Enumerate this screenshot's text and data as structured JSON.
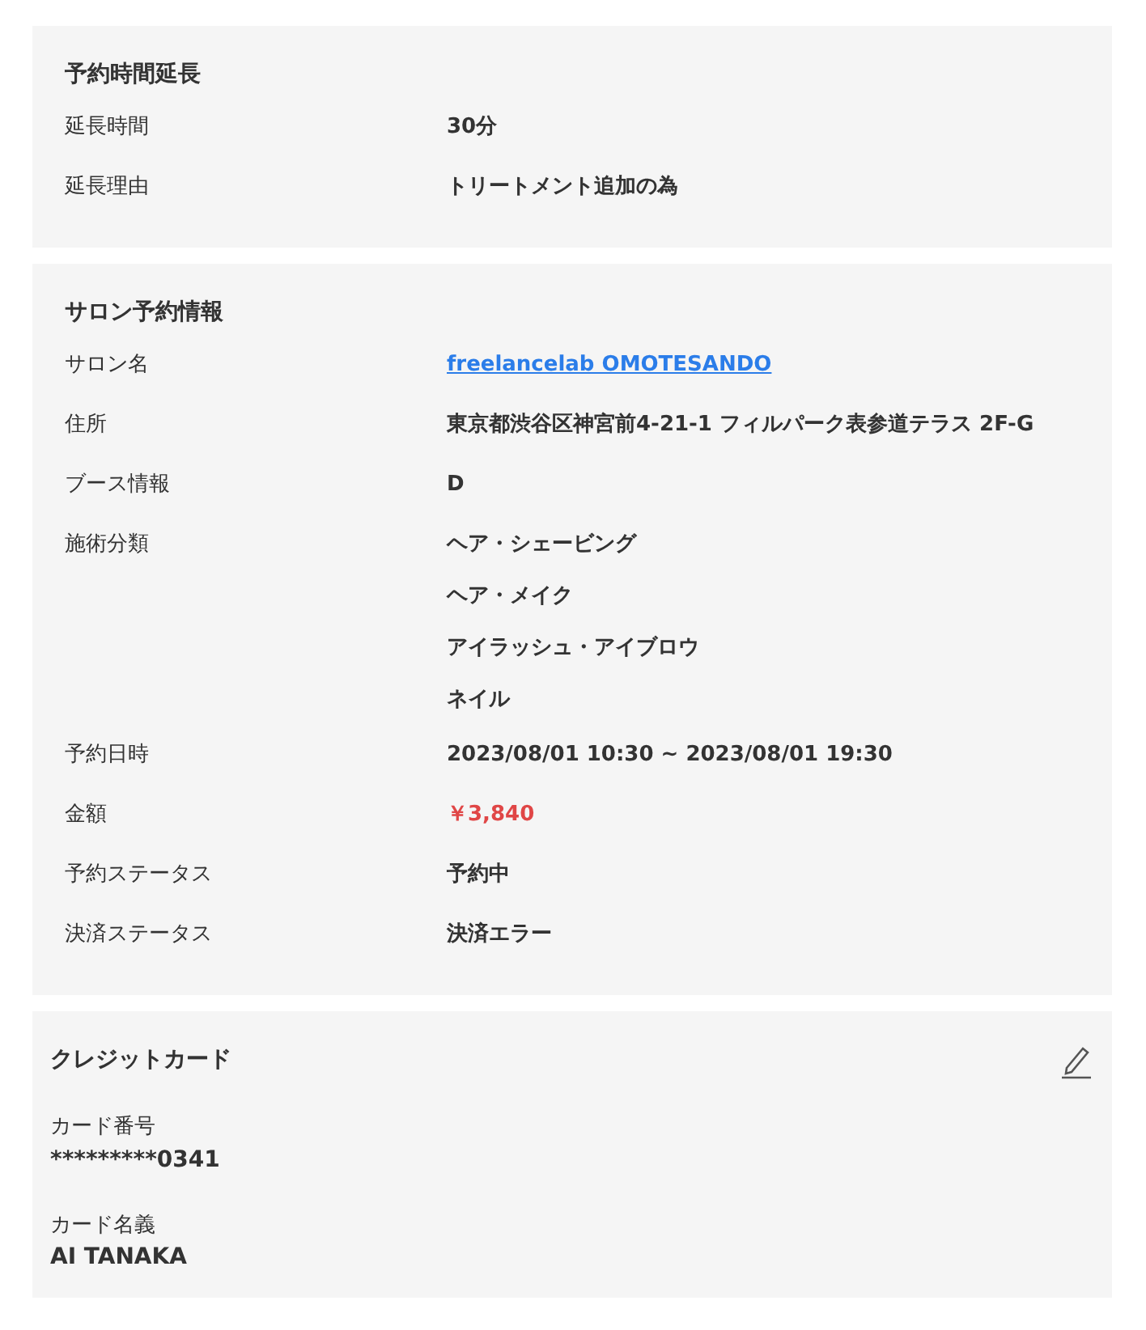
{
  "extension": {
    "title": "予約時間延長",
    "rows": [
      {
        "label": "延長時間",
        "kind": "text",
        "value": "30分"
      },
      {
        "label": "延長理由",
        "kind": "text",
        "value": "トリートメント追加の為"
      }
    ]
  },
  "salon": {
    "title": "サロン予約情報",
    "rows": [
      {
        "label": "サロン名",
        "kind": "link",
        "value": "freelancelab OMOTESANDO"
      },
      {
        "label": "住所",
        "kind": "text",
        "value": "東京都渋谷区神宮前4-21-1 フィルパーク表参道テラス 2F-G"
      },
      {
        "label": "ブース情報",
        "kind": "text",
        "value": "D"
      },
      {
        "label": "施術分類",
        "kind": "list",
        "values": [
          "ヘア・シェービング",
          "ヘア・メイク",
          "アイラッシュ・アイブロウ",
          "ネイル"
        ]
      },
      {
        "label": "予約日時",
        "kind": "text",
        "value": "2023/08/01 10:30 ~ 2023/08/01 19:30"
      },
      {
        "label": "金額",
        "kind": "price",
        "value": "￥3,840"
      },
      {
        "label": "予約ステータス",
        "kind": "text",
        "value": "予約中"
      },
      {
        "label": "決済ステータス",
        "kind": "text",
        "value": "決済エラー"
      }
    ]
  },
  "credit_card": {
    "title": "クレジットカード",
    "fields": [
      {
        "label": "カード番号",
        "value": "*********0341"
      },
      {
        "label": "カード名義",
        "value": "AI TANAKA"
      }
    ]
  }
}
